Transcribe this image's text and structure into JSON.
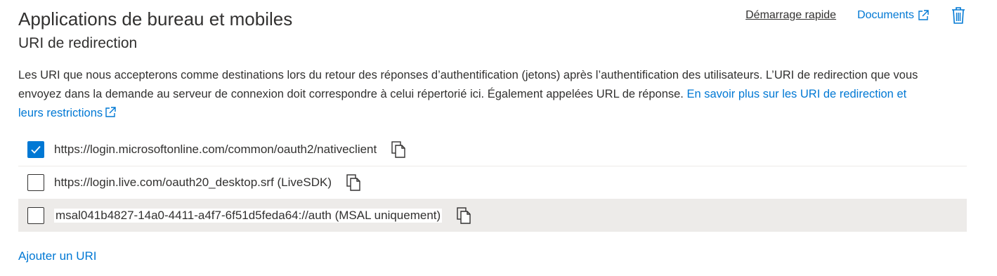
{
  "header": {
    "title": "Applications de bureau et mobiles",
    "subtitle": "URI de redirection",
    "quickstart_label": "Démarrage rapide",
    "docs_label": "Documents"
  },
  "description": {
    "text": "Les URI que nous accepterons comme destinations lors du retour des réponses d’authentification (jetons) après l’authentification des utilisateurs. L’URI de redirection que vous envoyez dans la demande au serveur de connexion doit correspondre à celui répertorié ici. Également appelées URL de réponse.",
    "link_text": "En savoir plus sur les URI de redirection et leurs restrictions"
  },
  "uris": [
    {
      "value": "https://login.microsoftonline.com/common/oauth2/nativeclient",
      "checked": true
    },
    {
      "value": "https://login.live.com/oauth20_desktop.srf (LiveSDK)",
      "checked": false
    },
    {
      "value": "msal041b4827-14a0-4411-a4f7-6f51d5feda64://auth (MSAL uniquement)",
      "checked": false
    }
  ],
  "add_uri_label": "Ajouter un URI",
  "colors": {
    "accent": "#0078d4",
    "text": "#323130",
    "row_highlight": "#edebe9"
  },
  "icons": {
    "external": "external-link-icon",
    "trash": "trash-icon",
    "copy": "copy-icon",
    "check": "check-icon"
  }
}
